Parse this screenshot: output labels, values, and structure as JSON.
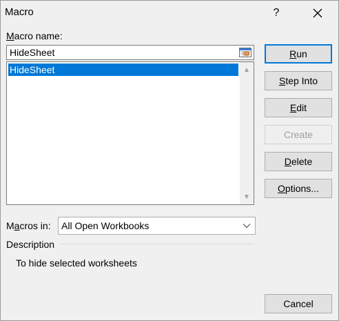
{
  "dialog": {
    "title": "Macro",
    "help_label": "?"
  },
  "macro_name": {
    "label_accel": "M",
    "label_rest": "acro name:",
    "value": "HideSheet"
  },
  "macro_list": {
    "items": [
      "HideSheet"
    ],
    "selected_index": 0
  },
  "buttons": {
    "run": {
      "accel": "R",
      "rest": "un"
    },
    "step_into": {
      "accel": "S",
      "rest": "tep Into"
    },
    "edit": {
      "accel": "E",
      "rest": "dit"
    },
    "create": {
      "label": "Create"
    },
    "delete": {
      "accel": "D",
      "rest": "elete"
    },
    "options": {
      "accel": "O",
      "rest": "ptions..."
    },
    "cancel": {
      "label": "Cancel"
    }
  },
  "macros_in": {
    "label_pre": "M",
    "label_accel": "a",
    "label_post": "cros in:",
    "value": "All Open Workbooks"
  },
  "description": {
    "label": "Description",
    "text": "To hide selected worksheets"
  },
  "colors": {
    "selection": "#0078d7",
    "dialog_bg": "#f0f0f0"
  }
}
